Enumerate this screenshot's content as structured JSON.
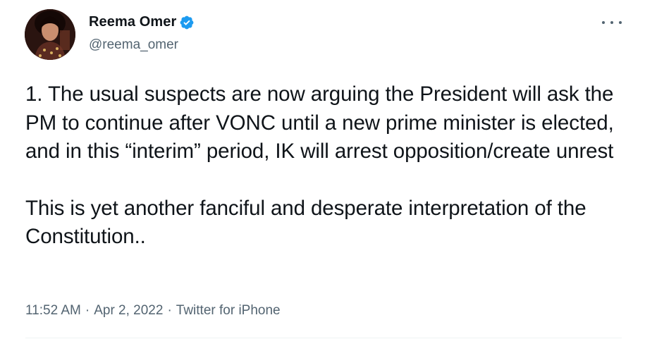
{
  "author": {
    "display_name": "Reema Omer",
    "handle": "@reema_omer",
    "verified": true,
    "avatar_icon": "profile-photo"
  },
  "tweet": {
    "paragraphs": [
      "1. The usual suspects are now arguing the President will ask the PM to continue after VONC until a new prime minister is elected, and in this “interim” period, IK will arrest opposition/create unrest",
      "This is yet another fanciful and desperate interpretation of the Constitution.."
    ],
    "time": "11:52 AM",
    "date": "Apr 2, 2022",
    "source": "Twitter for iPhone",
    "separator": "·"
  },
  "menu": {
    "icon": "more-icon"
  },
  "colors": {
    "text": "#0f1419",
    "secondary": "#536471",
    "verified_blue": "#1d9bf0",
    "background": "#ffffff"
  }
}
